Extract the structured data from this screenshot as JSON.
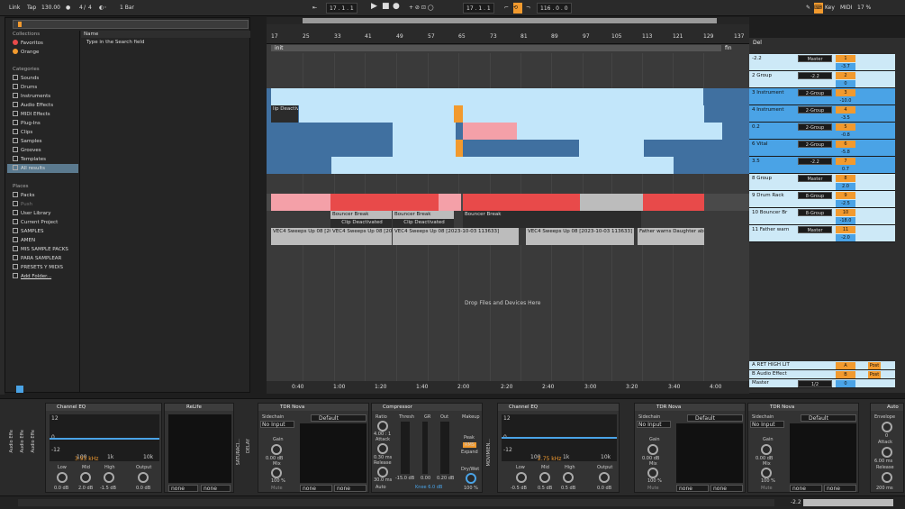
{
  "transport": {
    "link": "Link",
    "tap": "Tap",
    "tempo": "130.00",
    "meter_num": "4",
    "meter_den": "4",
    "quantize": "1 Bar",
    "position": "17 . 1 . 1",
    "loop_start": "17 . 1 . 1",
    "loop_len": "116 . 0 . 0",
    "key": "Key",
    "midi": "MIDI",
    "cpu": "17 %"
  },
  "browser": {
    "search_placeholder": "Type in the Search field",
    "name_col": "Name",
    "collections_head": "Collections",
    "collections": [
      "Favoritos",
      "Orange"
    ],
    "categories_head": "Categories",
    "categories": [
      "Sounds",
      "Drums",
      "Instruments",
      "Audio Effects",
      "MIDI Effects",
      "Plug-Ins",
      "Clips",
      "Samples",
      "Grooves",
      "Templates",
      "All results"
    ],
    "places_head": "Places",
    "places": [
      "Packs",
      "Push",
      "User Library",
      "Current Project",
      "SAMPLES",
      "AMEN",
      "MIS SAMPLE PACKS",
      "PARA SAMPLEAR",
      "PRESETS Y MIDIS",
      "Add Folder..."
    ]
  },
  "ruler": {
    "bars": [
      "17",
      "25",
      "33",
      "41",
      "49",
      "57",
      "65",
      "73",
      "81",
      "89",
      "97",
      "105",
      "113",
      "121",
      "129",
      "137"
    ],
    "times": [
      "0:40",
      "1:00",
      "1:20",
      "1:40",
      "2:00",
      "2:20",
      "2:40",
      "3:00",
      "3:20",
      "3:40",
      "4:00"
    ],
    "loc_init": "init",
    "loc_fin": "fin"
  },
  "clips": {
    "bouncer": "Bouncer Break",
    "deactivated": "Clip Deactivated",
    "deactivate_short": "lip Deactivate",
    "sweeps": "VEC4 Sweeps Up 08 [2023-10-03 113633]",
    "sweeps_short": "VEC4 Sweeps Up 08 [2023-",
    "father": "Father warns Daughter abou",
    "drop": "Drop Files and Devices Here"
  },
  "tracks": [
    {
      "name": "-2.2",
      "route": "Master",
      "num": "1",
      "vol": "-3.7"
    },
    {
      "name": "2 Group",
      "route": "-2.2",
      "num": "2",
      "vol": "0"
    },
    {
      "name": "3 Instrument",
      "route": "2-Group",
      "num": "3",
      "vol": "-10.0"
    },
    {
      "name": "4 Instrument",
      "route": "2-Group",
      "num": "4",
      "vol": "-3.5"
    },
    {
      "name": "0.2",
      "route": "2-Group",
      "num": "5",
      "vol": "-0.8"
    },
    {
      "name": "6 Vital",
      "route": "2-Group",
      "num": "6",
      "vol": "-5.8"
    },
    {
      "name": "3.5",
      "route": "-2.2",
      "num": "7",
      "vol": "0.7"
    },
    {
      "name": "8 Group",
      "route": "Master",
      "num": "8",
      "vol": "2.0"
    },
    {
      "name": "9 Drum Rack",
      "route": "8-Group",
      "num": "9",
      "vol": "-2.5"
    },
    {
      "name": "10 Bouncer Br",
      "route": "8-Group",
      "num": "10",
      "vol": "-18.0"
    },
    {
      "name": "11 Father warn",
      "route": "Master",
      "num": "11",
      "vol": "-2.0"
    }
  ],
  "returns": [
    {
      "name": "A RET HIGH LIT",
      "num": "A",
      "send": "Post"
    },
    {
      "name": "B Audio Effect",
      "num": "B",
      "send": "Post"
    },
    {
      "name": "Master",
      "route": "1/2",
      "num": "0"
    }
  ],
  "header_extra": {
    "del": "Del"
  },
  "devices": {
    "eq1": {
      "title": "Channel EQ",
      "freq": "3.93 kHz",
      "low": "Low",
      "mid": "Mid",
      "high": "High",
      "output": "Output",
      "low_v": "0.0 dB",
      "mid_v": "2.0 dB",
      "high_v": "-1.5 dB",
      "out_v": "0.0 dB",
      "db_top": "12",
      "db_zero": "0",
      "db_bot": "-12",
      "f1": "100",
      "f2": "1k",
      "f3": "10k"
    },
    "relife": {
      "title": "ReLife",
      "none1": "none",
      "none2": "none"
    },
    "tdr1": {
      "title": "TDR Nova",
      "sidechain": "Sidechain",
      "no_input": "No Input",
      "default": "Default",
      "gain": "Gain",
      "gain_v": "0.00 dB",
      "mix": "Mix",
      "mix_v": "100 %",
      "mute": "Mute",
      "none1": "none",
      "none2": "none"
    },
    "comp": {
      "title": "Compressor",
      "ratio": "Ratio",
      "ratio_v": "4.00 : 1",
      "attack": "Attack",
      "attack_v": "0.30 ms",
      "release": "Release",
      "release_v": "30.0 ms",
      "auto": "Auto",
      "thresh": "Thresh",
      "gr": "GR",
      "out": "Out",
      "thresh_v": "-15.0 dB",
      "gr_v": "0.00",
      "out_v": "0.20 dB",
      "knee": "Knee 6.0 dB",
      "makeup": "Makeup",
      "peak": "Peak",
      "rms": "RMS",
      "expand": "Expand",
      "drywet": "Dry/Wet",
      "drywet_v": "100 %"
    },
    "eq2": {
      "title": "Channel EQ",
      "freq": "2.75 kHz",
      "low": "Low",
      "mid": "Mid",
      "high": "High",
      "output": "Output",
      "low_v": "-0.5 dB",
      "mid_v": "0.5 dB",
      "high_v": "0.5 dB",
      "out_v": "0.0 dB",
      "db_top": "12",
      "db_zero": "0",
      "db_bot": "-12",
      "f1": "100",
      "f2": "1k",
      "f3": "10k"
    },
    "tdr2": {
      "title": "TDR Nova",
      "sidechain": "Sidechain",
      "no_input": "No Input",
      "default": "Default",
      "gain": "Gain",
      "gain_v": "0.00 dB",
      "mix": "Mix",
      "mix_v": "100 %",
      "mute": "Mute",
      "none1": "none",
      "none2": "none"
    },
    "tdr3": {
      "title": "TDR Nova",
      "sidechain": "Sidechain",
      "no_input": "No Input",
      "default": "Default",
      "gain": "Gain",
      "gain_v": "0.00 dB",
      "mix": "Mix",
      "mix_v": "100 %",
      "mute": "Mute",
      "none1": "none",
      "none2": "none"
    },
    "env": {
      "title": "Auto",
      "envelope": "Envelope",
      "env_v": "0",
      "attack": "Attack",
      "attack_v": "6.00 ms",
      "release": "Release",
      "release_v": "200 ms"
    },
    "side_labels": [
      "Audio Effe",
      "Audio Effe",
      "Audio Effe",
      "MOVIMIEN...",
      "SATURACI...",
      "DELAY"
    ]
  },
  "status": {
    "value": "-2.2"
  },
  "colors": {
    "accent": "#f29a2e",
    "clip_blue": "#9fd3f0",
    "clip_red": "#e84a4a",
    "clip_pink": "#f4a0a8",
    "track_blue": "#4aa3e6",
    "head_light": "#cde9f7"
  }
}
